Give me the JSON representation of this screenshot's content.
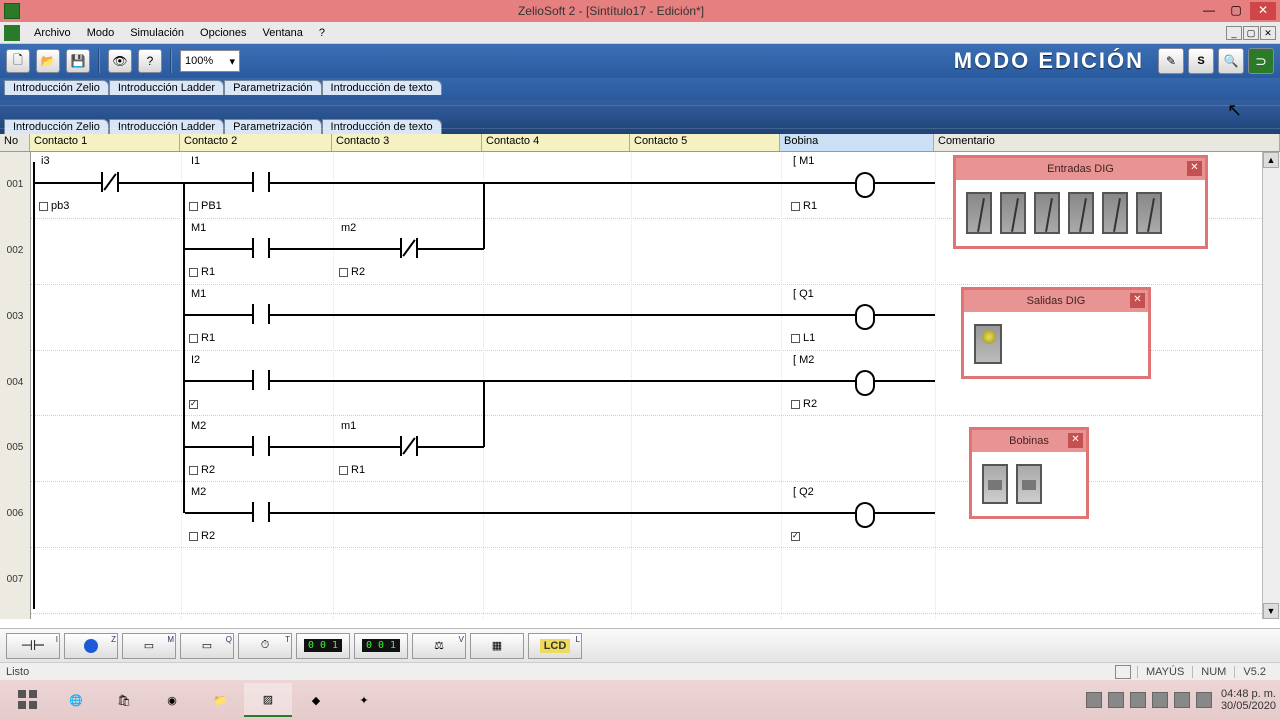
{
  "window": {
    "title": "ZelioSoft 2 - [Sintítulo17 - Edición*]"
  },
  "menu": {
    "items": [
      "Archivo",
      "Modo",
      "Simulación",
      "Opciones",
      "Ventana",
      "?"
    ]
  },
  "toolbar": {
    "zoom": "100%",
    "modo": "MODO EDICIÓN",
    "sim_s": "S"
  },
  "tabs": {
    "t": [
      "Introducción Zelio",
      "Introducción Ladder",
      "Parametrización",
      "Introducción de texto"
    ]
  },
  "columns": {
    "no": "No",
    "c": [
      "Contacto 1",
      "Contacto 2",
      "Contacto 3",
      "Contacto 4",
      "Contacto 5"
    ],
    "bob": "Bobina",
    "com": "Comentario"
  },
  "rows": [
    "001",
    "002",
    "003",
    "004",
    "005",
    "006",
    "007"
  ],
  "ladder": {
    "i3": "i3",
    "pb3": "pb3",
    "I1": "I1",
    "PB1": "PB1",
    "M1a": "M1",
    "m2": "m2",
    "R1a": "R1",
    "R2a": "R2",
    "M1b": "M1",
    "R1b": "R1",
    "I2": "I2",
    "M2a": "M2",
    "m1": "m1",
    "R2b": "R2",
    "R1c": "R1",
    "M2b": "M2",
    "R2c": "R2",
    "coilM1": "[ M1",
    "coilR1": "R1",
    "coilQ1": "[ Q1",
    "coilL1": "L1",
    "coilM2": "[ M2",
    "coilR2": "R2",
    "coilQ2": "[ Q2"
  },
  "palettes": {
    "dig_in": "Entradas DIG",
    "dig_out": "Salidas DIG",
    "bob": "Bobinas"
  },
  "simbar": {
    "i": "I",
    "z": "Z",
    "m": "M",
    "q": "Q",
    "t": "T",
    "c1": "0 0 1",
    "c2": "0 0 1",
    "v": "V",
    "lcd": "LCD",
    "l": "L"
  },
  "status": {
    "ready": "Listo",
    "mayus": "MAYÚS",
    "num": "NUM",
    "ver": "V5.2"
  },
  "clock": {
    "time": "04:48 p. m.",
    "date": "30/05/2020"
  }
}
